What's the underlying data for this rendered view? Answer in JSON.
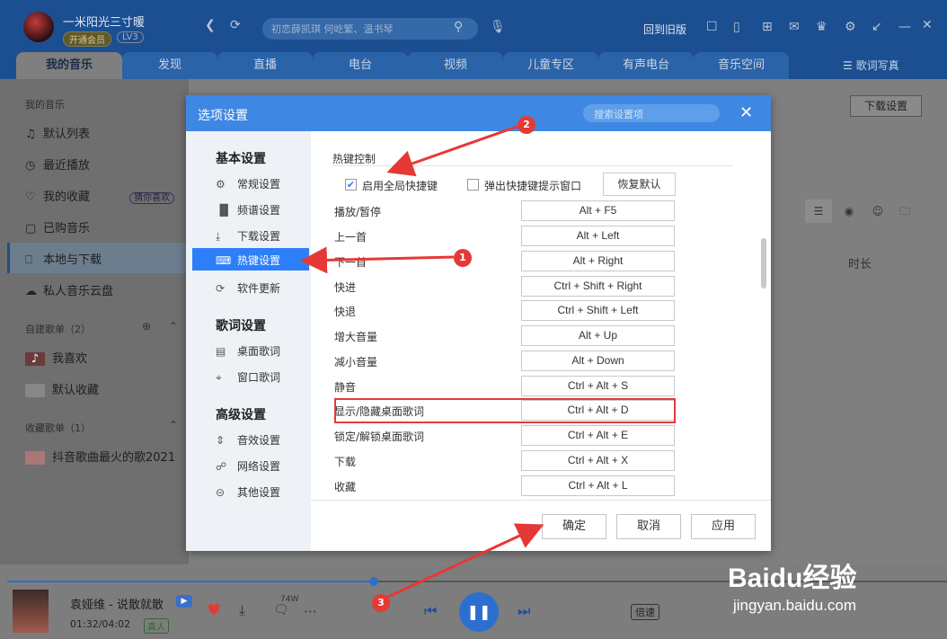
{
  "header": {
    "username": "一米阳光三寸暖",
    "vip_badge": "开通会员",
    "level_badge": "LV3",
    "search_placeholder": "初恋薛凯琪 何屹繁、温书琴",
    "old_version": "回到旧版"
  },
  "tabs": [
    "我的音乐",
    "发现",
    "直播",
    "电台",
    "视频",
    "儿童专区",
    "有声电台",
    "音乐空间"
  ],
  "lyric_tab": "歌词写真",
  "sidebar": {
    "section_title": "我的音乐",
    "items": [
      {
        "icon": "playlist-icon",
        "label": "默认列表"
      },
      {
        "icon": "clock-icon",
        "label": "最近播放"
      },
      {
        "icon": "heart-icon",
        "label": "我的收藏",
        "badge": "猜你喜欢"
      },
      {
        "icon": "bag-icon",
        "label": "已购音乐"
      },
      {
        "icon": "monitor-icon",
        "label": "本地与下载"
      },
      {
        "icon": "cloud-icon",
        "label": "私人音乐云盘"
      }
    ],
    "created_title": "自建歌单（2）",
    "created_items": [
      "我喜欢",
      "默认收藏"
    ],
    "collected_title": "收藏歌单（1）",
    "collected_items": [
      "抖音歌曲最火的歌2021"
    ]
  },
  "content": {
    "download_settings": "下载设置",
    "duration_header": "时长"
  },
  "dialog": {
    "title": "选项设置",
    "search_placeholder": "搜索设置项",
    "nav": {
      "basic_title": "基本设置",
      "basic_items": [
        {
          "icon": "gear-icon",
          "label": "常规设置"
        },
        {
          "icon": "spectrum-icon",
          "label": "频谱设置"
        },
        {
          "icon": "download-icon",
          "label": "下载设置"
        },
        {
          "icon": "keyboard-icon",
          "label": "热键设置"
        },
        {
          "icon": "update-icon",
          "label": "软件更新"
        }
      ],
      "lyrics_title": "歌词设置",
      "lyrics_items": [
        {
          "icon": "desktop-lyric-icon",
          "label": "桌面歌词"
        },
        {
          "icon": "window-lyric-icon",
          "label": "窗口歌词"
        }
      ],
      "advanced_title": "高级设置",
      "advanced_items": [
        {
          "icon": "equalizer-icon",
          "label": "音效设置"
        },
        {
          "icon": "network-icon",
          "label": "网络设置"
        },
        {
          "icon": "more-icon",
          "label": "其他设置"
        }
      ]
    },
    "section_title": "热键控制",
    "enable_global": {
      "label": "启用全局快捷键",
      "checked": true
    },
    "popup_hint": {
      "label": "弹出快捷键提示窗口",
      "checked": false
    },
    "restore_default": "恢复默认",
    "hotkeys": [
      {
        "action": "播放/暂停",
        "keys": "Alt + F5"
      },
      {
        "action": "上一首",
        "keys": "Alt + Left"
      },
      {
        "action": "下一首",
        "keys": "Alt + Right"
      },
      {
        "action": "快进",
        "keys": "Ctrl + Shift + Right"
      },
      {
        "action": "快退",
        "keys": "Ctrl + Shift + Left"
      },
      {
        "action": "增大音量",
        "keys": "Alt + Up"
      },
      {
        "action": "减小音量",
        "keys": "Alt + Down"
      },
      {
        "action": "静音",
        "keys": "Ctrl + Alt + S"
      },
      {
        "action": "显示/隐藏桌面歌词",
        "keys": "Ctrl + Alt + D"
      },
      {
        "action": "锁定/解锁桌面歌词",
        "keys": "Ctrl + Alt + E"
      },
      {
        "action": "下载",
        "keys": "Ctrl + Alt + X"
      },
      {
        "action": "收藏",
        "keys": "Ctrl + Alt + L"
      }
    ],
    "ok": "确定",
    "cancel": "取消",
    "apply": "应用"
  },
  "player": {
    "song": "袁娅维 - 说散就散",
    "time": "01:32/04:02",
    "quality_badge": "真人",
    "comment_count": "74W",
    "speed_label": "倍速",
    "progress": 0.39
  },
  "annotations": [
    "1",
    "2",
    "3"
  ],
  "watermark": {
    "brand": "Baidu经验",
    "url": "jingyan.baidu.com"
  },
  "colors": {
    "accent": "#2d7ff9",
    "header": "#3e88e3",
    "annotation": "#e53935"
  }
}
